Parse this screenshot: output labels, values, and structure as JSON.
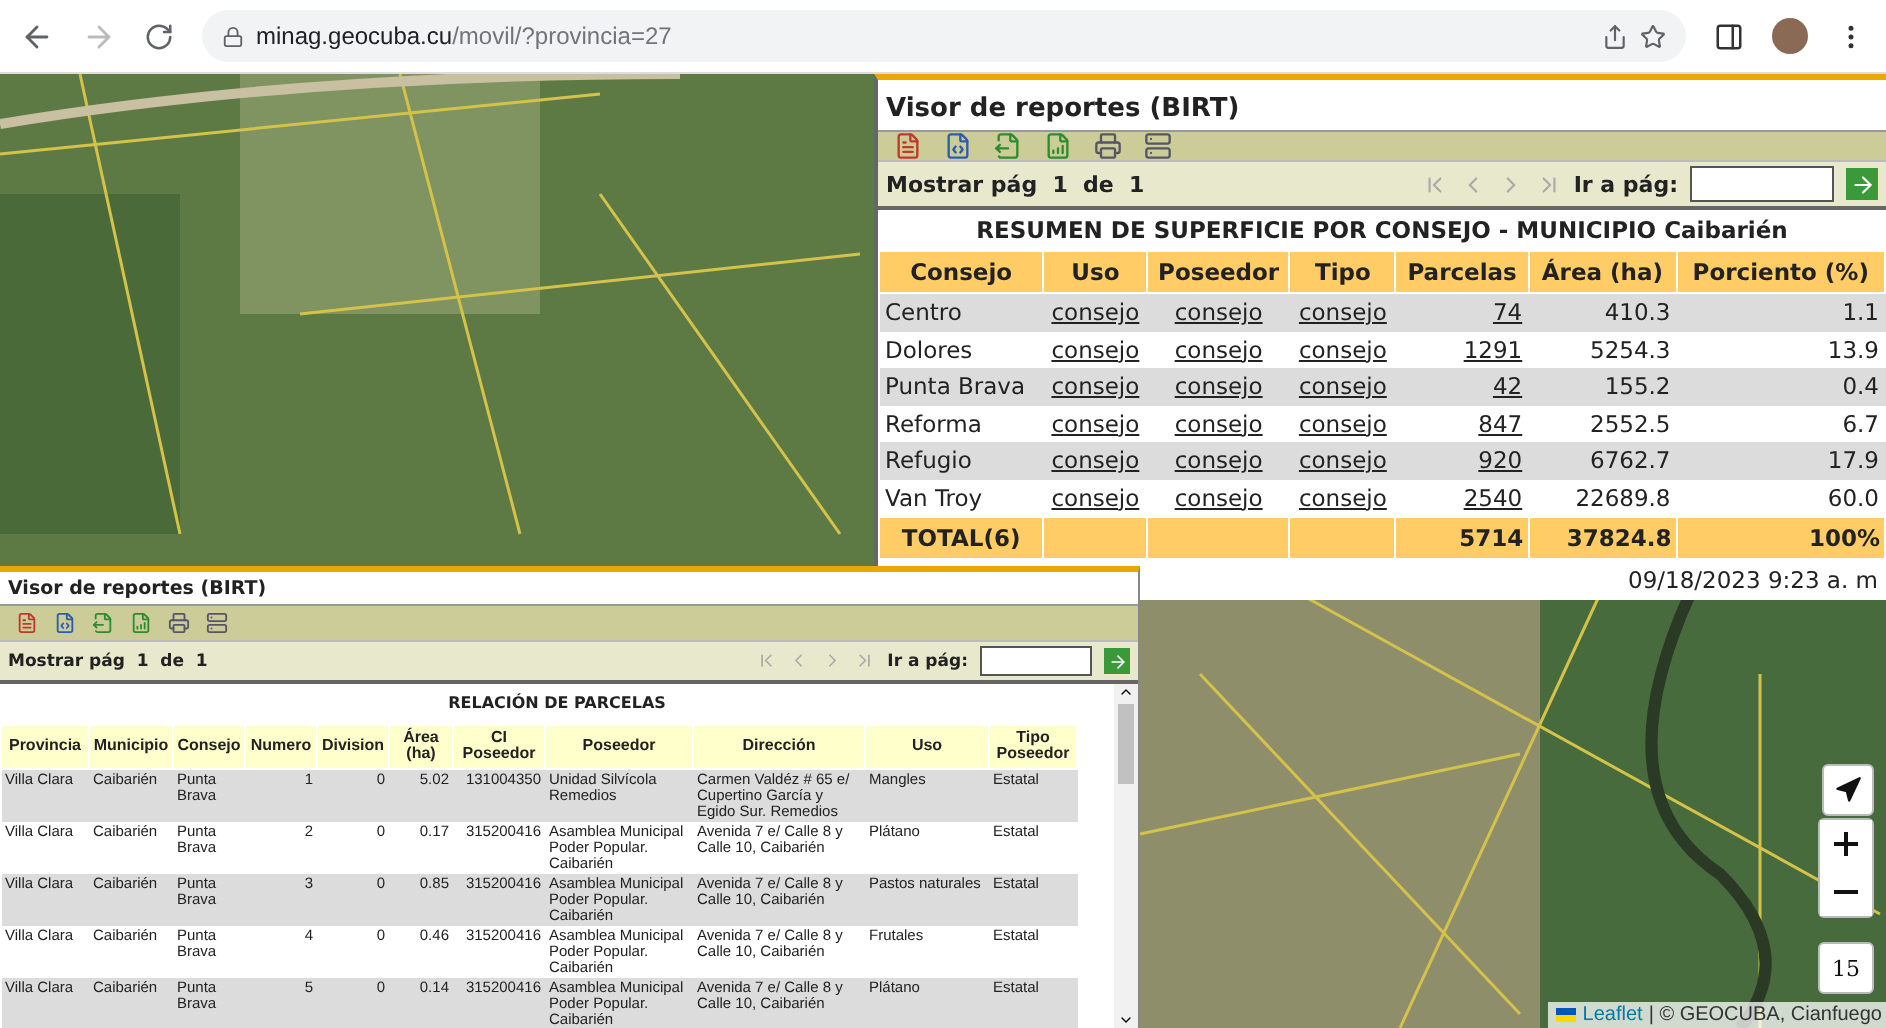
{
  "browser": {
    "url_domain": "minag.geocuba.cu",
    "url_path": "/movil/?provincia=27"
  },
  "map": {
    "attribution_link": "Leaflet",
    "attribution": "| © GEOCUBA, Cianfuego",
    "zoom_level": "15"
  },
  "summary_viewer": {
    "title": "Visor de reportes (BIRT)",
    "pager": {
      "show_label": "Mostrar pág  1  de  1",
      "goto_label": "Ir a pág:"
    },
    "report_title": "RESUMEN DE SUPERFICIE POR CONSEJO - MUNICIPIO Caibarién",
    "columns": [
      "Consejo",
      "Uso",
      "Poseedor",
      "Tipo",
      "Parcelas",
      "Área (ha)",
      "Porciento (%)"
    ],
    "rows": [
      {
        "consejo": "Centro",
        "uso": "consejo",
        "poseedor": "consejo",
        "tipo": "consejo",
        "parcelas": "74",
        "area": "410.3",
        "porciento": "1.1"
      },
      {
        "consejo": "Dolores",
        "uso": "consejo",
        "poseedor": "consejo",
        "tipo": "consejo",
        "parcelas": "1291",
        "area": "5254.3",
        "porciento": "13.9"
      },
      {
        "consejo": "Punta Brava",
        "uso": "consejo",
        "poseedor": "consejo",
        "tipo": "consejo",
        "parcelas": "42",
        "area": "155.2",
        "porciento": "0.4"
      },
      {
        "consejo": "Reforma",
        "uso": "consejo",
        "poseedor": "consejo",
        "tipo": "consejo",
        "parcelas": "847",
        "area": "2552.5",
        "porciento": "6.7"
      },
      {
        "consejo": "Refugio",
        "uso": "consejo",
        "poseedor": "consejo",
        "tipo": "consejo",
        "parcelas": "920",
        "area": "6762.7",
        "porciento": "17.9"
      },
      {
        "consejo": "Van Troy",
        "uso": "consejo",
        "poseedor": "consejo",
        "tipo": "consejo",
        "parcelas": "2540",
        "area": "22689.8",
        "porciento": "60.0"
      }
    ],
    "total": {
      "label": "TOTAL(6)",
      "parcelas": "5714",
      "area": "37824.8",
      "porciento": "100%"
    },
    "timestamp": "09/18/2023 9:23 a. m"
  },
  "parcels_viewer": {
    "title": "Visor de reportes (BIRT)",
    "pager": {
      "show_label": "Mostrar pág  1  de  1",
      "goto_label": "Ir a pág:"
    },
    "report_title": "RELACIÓN DE PARCELAS",
    "columns": [
      "Provincia",
      "Municipio",
      "Consejo",
      "Numero",
      "Division",
      "Área (ha)",
      "CI Poseedor",
      "Poseedor",
      "Dirección",
      "Uso",
      "Tipo Poseedor"
    ],
    "rows": [
      [
        "Villa Clara",
        "Caibarién",
        "Punta Brava",
        "1",
        "0",
        "5.02",
        "131004350",
        "Unidad Silvícola Remedios",
        "Carmen Valdéz # 65 e/ Cupertino García y Egido Sur. Remedios",
        "Mangles",
        "Estatal"
      ],
      [
        "Villa Clara",
        "Caibarién",
        "Punta Brava",
        "2",
        "0",
        "0.17",
        "315200416",
        "Asamblea Municipal Poder Popular. Caibarién",
        "Avenida 7 e/ Calle 8 y Calle 10, Caibarién",
        "Plátano",
        "Estatal"
      ],
      [
        "Villa Clara",
        "Caibarién",
        "Punta Brava",
        "3",
        "0",
        "0.85",
        "315200416",
        "Asamblea Municipal Poder Popular. Caibarién",
        "Avenida 7 e/ Calle 8 y Calle 10, Caibarién",
        "Pastos naturales",
        "Estatal"
      ],
      [
        "Villa Clara",
        "Caibarién",
        "Punta Brava",
        "4",
        "0",
        "0.46",
        "315200416",
        "Asamblea Municipal Poder Popular. Caibarién",
        "Avenida 7 e/ Calle 8 y Calle 10, Caibarién",
        "Frutales",
        "Estatal"
      ],
      [
        "Villa Clara",
        "Caibarién",
        "Punta Brava",
        "5",
        "0",
        "0.14",
        "315200416",
        "Asamblea Municipal Poder Popular. Caibarién",
        "Avenida 7 e/ Calle 8 y Calle 10, Caibarién",
        "Plátano",
        "Estatal"
      ]
    ]
  }
}
